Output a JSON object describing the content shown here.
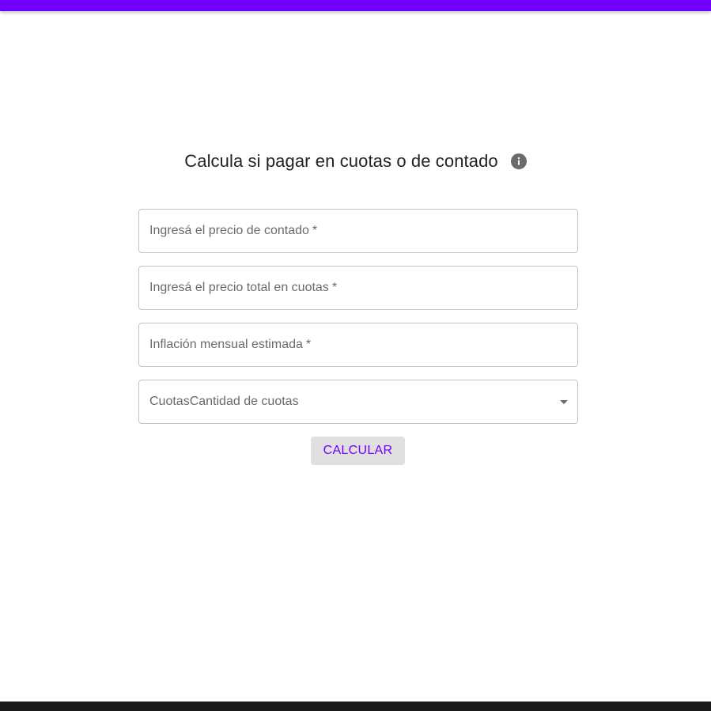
{
  "colors": {
    "accent": "#7000ff",
    "footer": "#1b1b1b",
    "button_bg": "#e0e0e0",
    "field_border": "#c4c4c4"
  },
  "header": {
    "title": "Calcula si pagar en cuotas o de contado",
    "info_icon": "info-icon"
  },
  "form": {
    "cash_price": {
      "label": "Ingresá el precio de contado",
      "required_mark": "*",
      "value": ""
    },
    "installment_total": {
      "label": "Ingresá el precio total en cuotas",
      "required_mark": "*",
      "value": ""
    },
    "inflation": {
      "label": "Inflación mensual estimada",
      "required_mark": "*",
      "value": ""
    },
    "installments_select": {
      "label": "CuotasCantidad de cuotas",
      "icon": "chevron-down-icon"
    },
    "calculate_label": "CALCULAR"
  }
}
